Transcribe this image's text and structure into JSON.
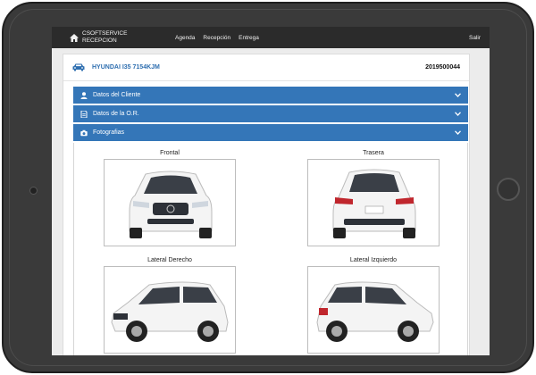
{
  "nav": {
    "brand_line1": "CSOFTSERVICE",
    "brand_line2": "RECEPCION",
    "links": [
      "Agenda",
      "Recepción",
      "Entrega"
    ],
    "logout": "Salir"
  },
  "vehicle": {
    "name": "HYUNDAI I35 7154KJM",
    "order_number": "2019500044"
  },
  "sections": [
    {
      "label": "Datos del Cliente",
      "icon": "user-icon"
    },
    {
      "label": "Datos de la O.R.",
      "icon": "document-icon"
    },
    {
      "label": "Fotografias",
      "icon": "camera-icon"
    }
  ],
  "photos": [
    {
      "title": "Frontal",
      "view": "front"
    },
    {
      "title": "Trasera",
      "view": "rear"
    },
    {
      "title": "Lateral Derecho",
      "view": "side-right"
    },
    {
      "title": "Lateral Izquierdo",
      "view": "side-left"
    }
  ],
  "colors": {
    "accent": "#3476b8",
    "nav_bg": "#2b2b2b",
    "vehicle_text": "#2f6fb0"
  }
}
